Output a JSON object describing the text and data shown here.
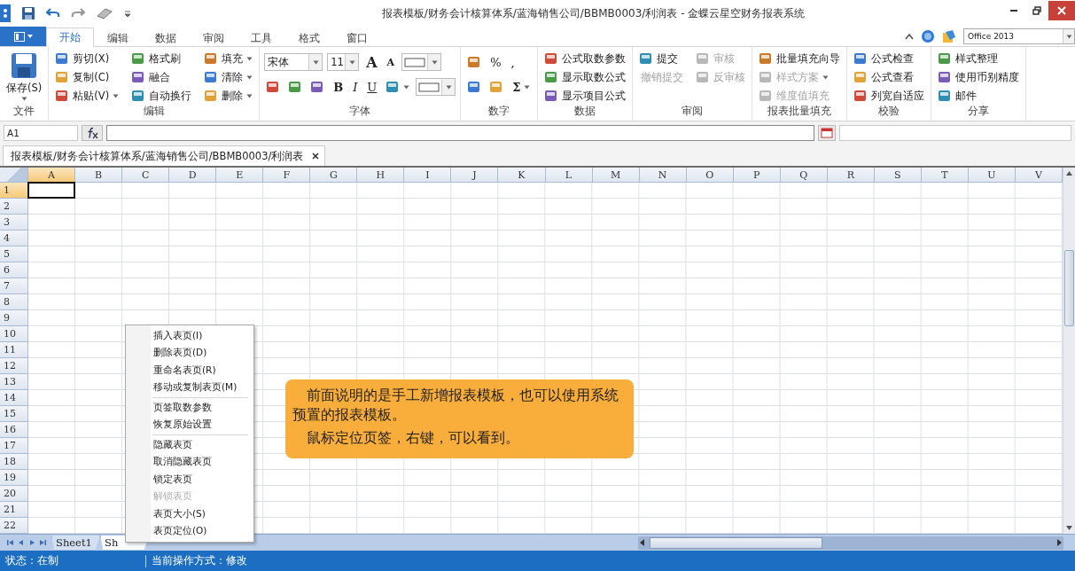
{
  "title_bar": {
    "title": "报表模板/财务会计核算体系/蓝海销售公司/BBMB0003/利润表 - 金蝶云星空财务报表系统"
  },
  "ribbon": {
    "tabs": [
      {
        "label": "开始",
        "selected": true
      },
      {
        "label": "编辑",
        "selected": false
      },
      {
        "label": "数据",
        "selected": false
      },
      {
        "label": "审阅",
        "selected": false
      },
      {
        "label": "工具",
        "selected": false
      },
      {
        "label": "格式",
        "selected": false
      },
      {
        "label": "窗口",
        "selected": false
      }
    ],
    "style_select": {
      "value": "Office 2013"
    },
    "groups": [
      {
        "label": "文件",
        "kind": "columns",
        "lines": [
          [
            {
              "kind": "large",
              "label": "保存(S)",
              "dropdown": true,
              "disabled": false
            }
          ]
        ]
      },
      {
        "label": "编辑",
        "kind": "columns",
        "lines": [
          [
            {
              "kind": "small",
              "label": "剪切(X)",
              "dropdown": false,
              "disabled": false
            },
            {
              "kind": "small",
              "label": "复制(C)",
              "dropdown": false,
              "disabled": false
            },
            {
              "kind": "small",
              "label": "粘贴(V)",
              "dropdown": true,
              "disabled": false
            }
          ],
          [
            {
              "kind": "small",
              "label": "格式刷",
              "dropdown": false,
              "disabled": false
            },
            {
              "kind": "small",
              "label": "融合",
              "dropdown": false,
              "disabled": false
            },
            {
              "kind": "small",
              "label": "自动换行",
              "dropdown": false,
              "disabled": false
            }
          ],
          [
            {
              "kind": "small",
              "label": "填充",
              "dropdown": true,
              "disabled": false
            },
            {
              "kind": "small",
              "label": "清除",
              "dropdown": true,
              "disabled": false
            },
            {
              "kind": "small",
              "label": "删除",
              "dropdown": true,
              "disabled": false
            }
          ]
        ]
      },
      {
        "label": "字体",
        "kind": "rows",
        "lines": [
          [
            {
              "kind": "fontname",
              "label": "宋体"
            },
            {
              "kind": "fontsize",
              "label": "11"
            },
            {
              "kind": "grow",
              "label": "A"
            },
            {
              "kind": "shrink",
              "label": "A"
            },
            {
              "kind": "swatch"
            }
          ],
          [
            {
              "kind": "icon"
            },
            {
              "kind": "icon"
            },
            {
              "kind": "icon"
            },
            {
              "kind": "glyph",
              "label": "B",
              "bold": true,
              "italic": false,
              "underline": false
            },
            {
              "kind": "glyph",
              "label": "I",
              "bold": false,
              "italic": true,
              "underline": false
            },
            {
              "kind": "glyph",
              "label": "U",
              "bold": false,
              "italic": false,
              "underline": true
            },
            {
              "kind": "icon",
              "dropdown": true
            },
            {
              "kind": "swatch"
            }
          ]
        ]
      },
      {
        "label": "数字",
        "kind": "rows",
        "lines": [
          [
            {
              "kind": "icon"
            },
            {
              "kind": "glyph",
              "label": "%"
            },
            {
              "kind": "glyph",
              "label": ","
            }
          ],
          [
            {
              "kind": "icon"
            },
            {
              "kind": "icon"
            },
            {
              "kind": "glyph",
              "label": "Σ",
              "bold": true,
              "dropdown": true
            }
          ]
        ]
      },
      {
        "label": "数据",
        "kind": "columns",
        "lines": [
          [
            {
              "kind": "small",
              "label": "公式取数参数",
              "dropdown": false,
              "disabled": false
            },
            {
              "kind": "small",
              "label": "显示取数公式",
              "dropdown": false,
              "disabled": false
            },
            {
              "kind": "small",
              "label": "显示项目公式",
              "dropdown": false,
              "disabled": false
            }
          ]
        ]
      },
      {
        "label": "审阅",
        "kind": "columns",
        "lines": [
          [
            {
              "kind": "small",
              "label": "提交",
              "dropdown": false,
              "disabled": false
            },
            {
              "kind": "text",
              "label": "撤销提交",
              "dropdown": false,
              "disabled": true
            }
          ],
          [
            {
              "kind": "small",
              "label": "审核",
              "dropdown": false,
              "disabled": true
            },
            {
              "kind": "small",
              "label": "反审核",
              "dropdown": false,
              "disabled": true
            }
          ]
        ]
      },
      {
        "label": "报表批量填充",
        "kind": "columns",
        "lines": [
          [
            {
              "kind": "small",
              "label": "批量填充向导",
              "dropdown": false,
              "disabled": false
            },
            {
              "kind": "small",
              "label": "样式方案",
              "dropdown": true,
              "disabled": true
            },
            {
              "kind": "small",
              "label": "维度值填充",
              "dropdown": false,
              "disabled": true
            }
          ]
        ]
      },
      {
        "label": "校验",
        "kind": "columns",
        "lines": [
          [
            {
              "kind": "small",
              "label": "公式检查",
              "dropdown": false,
              "disabled": false
            },
            {
              "kind": "small",
              "label": "公式查看",
              "dropdown": false,
              "disabled": false
            },
            {
              "kind": "small",
              "label": "列宽自适应",
              "dropdown": false,
              "disabled": false
            }
          ]
        ]
      },
      {
        "label": "分享",
        "kind": "columns",
        "lines": [
          [
            {
              "kind": "small",
              "label": "样式整理",
              "dropdown": false,
              "disabled": false
            },
            {
              "kind": "small",
              "label": "使用币别精度",
              "dropdown": false,
              "disabled": false
            },
            {
              "kind": "small",
              "label": "邮件",
              "dropdown": false,
              "disabled": false
            }
          ]
        ]
      }
    ]
  },
  "formula_bar": {
    "cell_name": "A1"
  },
  "document_tabs": [
    {
      "label": "报表模板/财务会计核算体系/蓝海销售公司/BBMB0003/利润表",
      "selected": true
    }
  ],
  "grid": {
    "columns": [
      {
        "label": "A",
        "selected": true
      },
      {
        "label": "B",
        "selected": false
      },
      {
        "label": "C",
        "selected": false
      },
      {
        "label": "D",
        "selected": false
      },
      {
        "label": "E",
        "selected": false
      },
      {
        "label": "F",
        "selected": false
      },
      {
        "label": "G",
        "selected": false
      },
      {
        "label": "H",
        "selected": false
      },
      {
        "label": "I",
        "selected": false
      },
      {
        "label": "J",
        "selected": false
      },
      {
        "label": "K",
        "selected": false
      },
      {
        "label": "L",
        "selected": false
      },
      {
        "label": "M",
        "selected": false
      },
      {
        "label": "N",
        "selected": false
      },
      {
        "label": "O",
        "selected": false
      },
      {
        "label": "P",
        "selected": false
      },
      {
        "label": "Q",
        "selected": false
      },
      {
        "label": "R",
        "selected": false
      },
      {
        "label": "S",
        "selected": false
      },
      {
        "label": "T",
        "selected": false
      },
      {
        "label": "U",
        "selected": false
      },
      {
        "label": "V",
        "selected": false
      }
    ],
    "rows": [
      {
        "label": "1",
        "selected": true
      },
      {
        "label": "2",
        "selected": false
      },
      {
        "label": "3",
        "selected": false
      },
      {
        "label": "4",
        "selected": false
      },
      {
        "label": "5",
        "selected": false
      },
      {
        "label": "6",
        "selected": false
      },
      {
        "label": "7",
        "selected": false
      },
      {
        "label": "8",
        "selected": false
      },
      {
        "label": "9",
        "selected": false
      },
      {
        "label": "10",
        "selected": false
      },
      {
        "label": "11",
        "selected": false
      },
      {
        "label": "12",
        "selected": false
      },
      {
        "label": "13",
        "selected": false
      },
      {
        "label": "14",
        "selected": false
      },
      {
        "label": "15",
        "selected": false
      },
      {
        "label": "16",
        "selected": false
      },
      {
        "label": "17",
        "selected": false
      },
      {
        "label": "18",
        "selected": false
      },
      {
        "label": "19",
        "selected": false
      },
      {
        "label": "20",
        "selected": false
      },
      {
        "label": "21",
        "selected": false
      },
      {
        "label": "22",
        "selected": false
      }
    ]
  },
  "context_menu": {
    "groups": [
      [
        {
          "label": "插入表页(I)",
          "disabled": false
        },
        {
          "label": "删除表页(D)",
          "disabled": false
        },
        {
          "label": "重命名表页(R)",
          "disabled": false
        },
        {
          "label": "移动或复制表页(M)",
          "disabled": false
        }
      ],
      [
        {
          "label": "页签取数参数",
          "disabled": false
        },
        {
          "label": "恢复原始设置",
          "disabled": false
        }
      ],
      [
        {
          "label": "隐藏表页",
          "disabled": false
        },
        {
          "label": "取消隐藏表页",
          "disabled": false
        },
        {
          "label": "锁定表页",
          "disabled": false
        },
        {
          "label": "解锁表页",
          "disabled": true
        },
        {
          "label": "表页大小(S)",
          "disabled": false
        },
        {
          "label": "表页定位(O)",
          "disabled": false
        }
      ]
    ]
  },
  "callout": {
    "paragraphs": [
      "前面说明的是手工新增报表模板，也可以使用系统预置的报表模板。",
      "鼠标定位页签，右键，可以看到。"
    ]
  },
  "sheet_tabs": [
    {
      "label": "Sheet1",
      "selected": false
    },
    {
      "label": "Sh",
      "selected": true
    }
  ],
  "status_bar": {
    "items": [
      "状态：在制",
      "当前操作方式：修改"
    ]
  }
}
